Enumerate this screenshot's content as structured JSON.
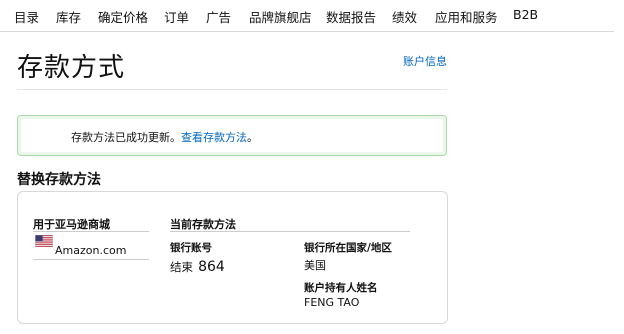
{
  "nav": {
    "items": [
      "目录",
      "库存",
      "确定价格",
      "订单",
      "广告",
      "品牌旗舰店",
      "数据报告",
      "绩效",
      "应用和服务",
      "B2B"
    ]
  },
  "header": {
    "title": "存款方式",
    "account_link": "账户信息"
  },
  "alert": {
    "message": "存款方法已成功更新。",
    "link": "查看存款方法",
    "end": "。"
  },
  "section": {
    "heading": "替换存款方法"
  },
  "card": {
    "marketplace_header": "用于亚马逊商城",
    "marketplace_icon": "us-flag-icon",
    "marketplace_name": "Amazon.com",
    "method_header": "当前存款方法",
    "account_label": "银行账号",
    "account_prefix": "结束",
    "account_last_digits": "864",
    "country_label": "银行所在国家/地区",
    "country_value": "美国",
    "holder_label": "账户持有人姓名",
    "holder_value": "FENG TAO"
  },
  "colors": {
    "link": "#0066c0",
    "success_border": "#a8dba8",
    "divider": "#d5d9d9"
  }
}
